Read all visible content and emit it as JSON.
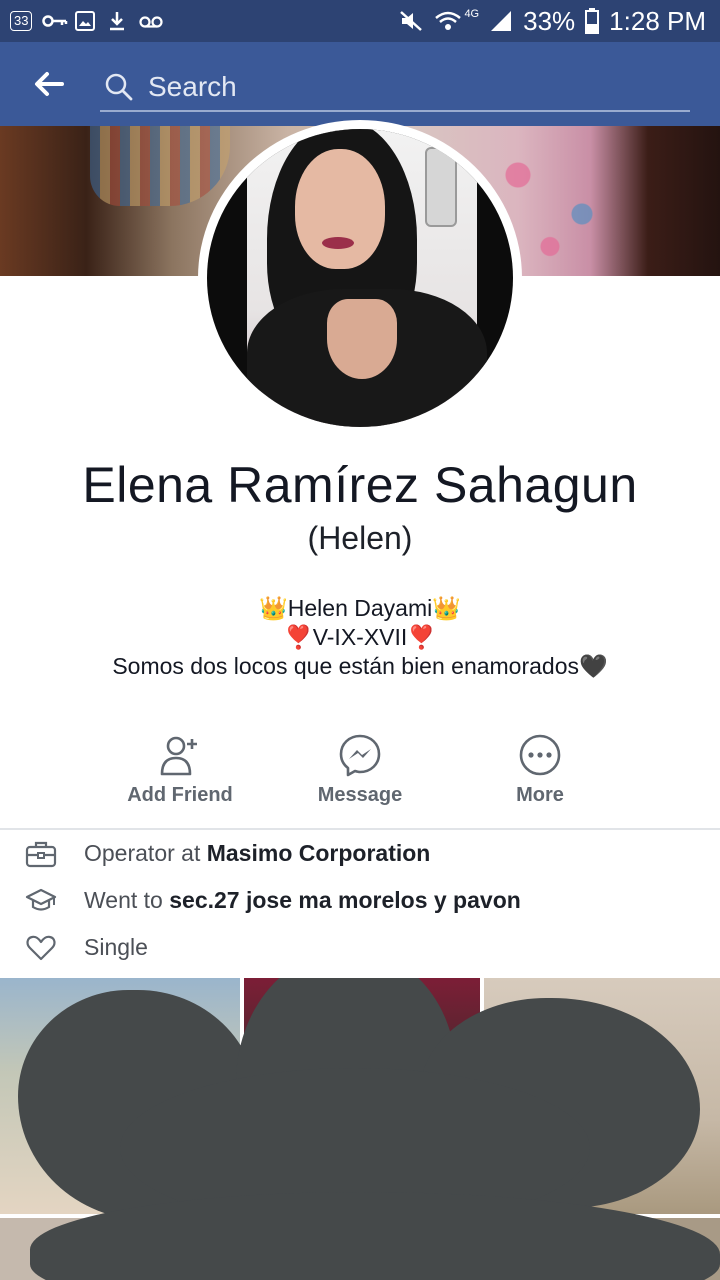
{
  "status_bar": {
    "notification_count": "33",
    "battery": "33%",
    "network": "4G",
    "time": "1:28 PM"
  },
  "app_bar": {
    "search_placeholder": "Search",
    "back_icon": "arrow-left-icon"
  },
  "profile": {
    "name": "Elena Ramírez Sahagun",
    "nickname": "(Helen)",
    "bio": [
      "👑Helen Dayami👑",
      "❣️V-IX-XVII❣️",
      "Somos dos locos que están bien enamorados🖤"
    ]
  },
  "actions": [
    {
      "label": "Add Friend",
      "icon": "add-friend-icon"
    },
    {
      "label": "Message",
      "icon": "messenger-icon"
    },
    {
      "label": "More",
      "icon": "more-icon"
    }
  ],
  "info": {
    "work_prefix": "Operator at ",
    "work_place": "Masimo Corporation",
    "education_prefix": "Went to ",
    "education_place": "sec.27 jose ma morelos y pavon",
    "relationship": "Single"
  },
  "colors": {
    "status_bar": "#2d4373",
    "app_bar": "#3b5998",
    "action_gray": "#606770",
    "redaction": "#45494a"
  }
}
